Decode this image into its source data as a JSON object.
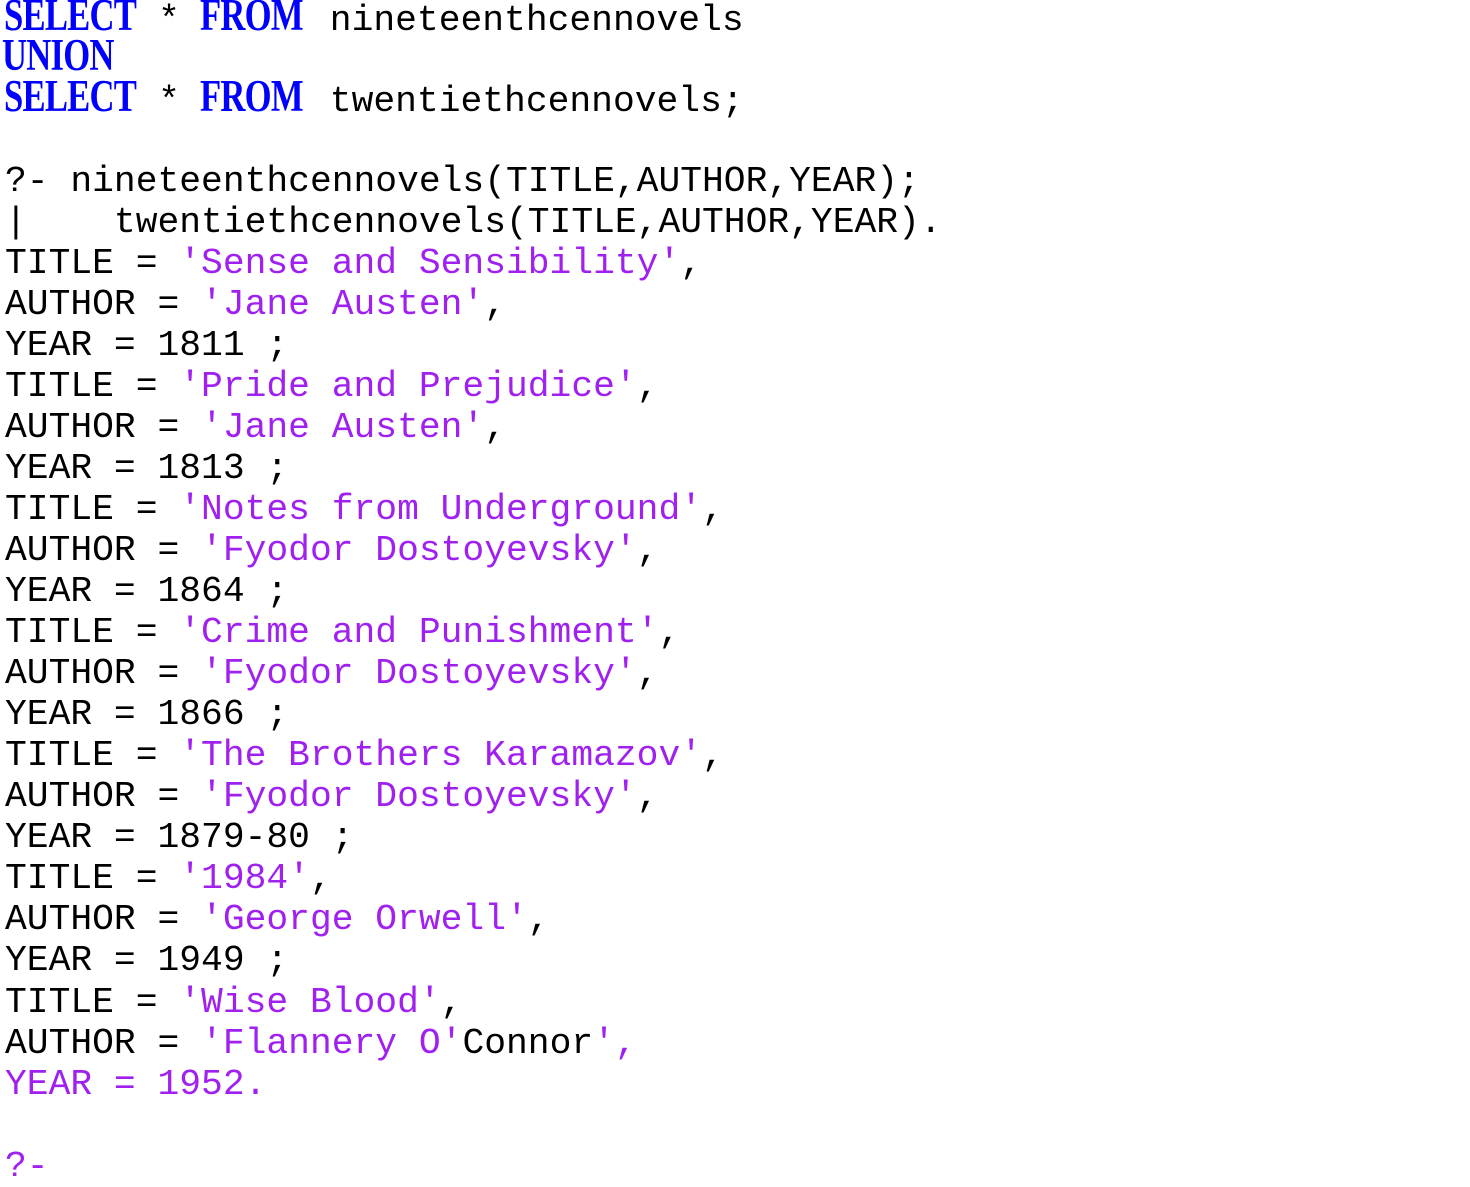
{
  "colors": {
    "keyword": "#0000ff",
    "string": "#a020f0",
    "text": "#000000",
    "background": "#ffffff"
  },
  "sql": {
    "select_kw": "SELECT",
    "star": "*",
    "from_kw": "FROM",
    "union_kw": "UNION",
    "table1": " nineteenthcennovels",
    "table2": " twentiethcennovels;"
  },
  "query": {
    "line1": "?- nineteenthcennovels(TITLE,AUTHOR,YEAR);",
    "line2": "|    twentiethcennovels(TITLE,AUTHOR,YEAR)."
  },
  "results": [
    {
      "title_prefix": "TITLE = ",
      "title": "'Sense and Sensibility'",
      "title_suffix": ",",
      "author_prefix": "AUTHOR = ",
      "author": "'Jane Austen'",
      "author_suffix": ",",
      "year_text": "YEAR = 1811 ;"
    },
    {
      "title_prefix": "TITLE = ",
      "title": "'Pride and Prejudice'",
      "title_suffix": ",",
      "author_prefix": "AUTHOR = ",
      "author": "'Jane Austen'",
      "author_suffix": ",",
      "year_text": "YEAR = 1813 ;"
    },
    {
      "title_prefix": "TITLE = ",
      "title": "'Notes from Underground'",
      "title_suffix": ",",
      "author_prefix": "AUTHOR = ",
      "author": "'Fyodor Dostoyevsky'",
      "author_suffix": ",",
      "year_text": "YEAR = 1864 ;"
    },
    {
      "title_prefix": "TITLE = ",
      "title": "'Crime and Punishment'",
      "title_suffix": ",",
      "author_prefix": "AUTHOR = ",
      "author": "'Fyodor Dostoyevsky'",
      "author_suffix": ",",
      "year_text": "YEAR = 1866 ;"
    },
    {
      "title_prefix": "TITLE = ",
      "title": "'The Brothers Karamazov'",
      "title_suffix": ",",
      "author_prefix": "AUTHOR = ",
      "author": "'Fyodor Dostoyevsky'",
      "author_suffix": ",",
      "year_text": "YEAR = 1879-80 ;"
    },
    {
      "title_prefix": "TITLE = ",
      "title": "'1984'",
      "title_suffix": ",",
      "author_prefix": "AUTHOR = ",
      "author": "'George Orwell'",
      "author_suffix": ",",
      "year_text": "YEAR = 1949 ;"
    }
  ],
  "last_result": {
    "title_prefix": "TITLE = ",
    "title": "'Wise Blood'",
    "title_suffix": ",",
    "author_prefix": "AUTHOR = ",
    "author_part1": "'Flannery O'",
    "author_part2": "Connor",
    "author_part3": "',",
    "year_text": "YEAR = 1952."
  },
  "prompt": "?-"
}
